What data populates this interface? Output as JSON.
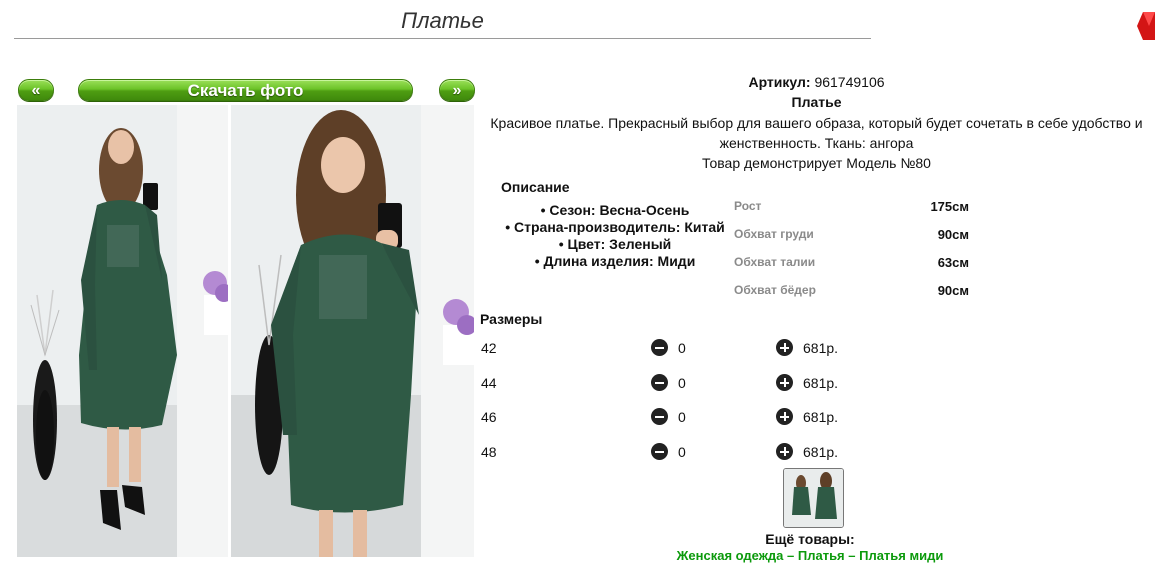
{
  "page": {
    "title": "Платье"
  },
  "gallery": {
    "prev_label": "«",
    "download_label": "Скачать фото",
    "next_label": "»"
  },
  "product": {
    "article_label": "Артикул:",
    "article_value": "961749106",
    "name": "Платье",
    "description": "Красивое платье. Прекрасный выбор для вашего образа, который будет сочетать в себе удобство и женственность. Ткань: ангора",
    "model_note": "Товар демонстрирует Модель №80"
  },
  "description_block": {
    "heading": "Описание",
    "items": [
      "• Сезон: Весна-Осень",
      "• Страна-производитель: Китай",
      "• Цвет: Зеленый",
      "• Длина изделия: Миди"
    ]
  },
  "measurements": [
    {
      "label": "Рост",
      "value": "175см"
    },
    {
      "label": "Обхват груди",
      "value": "90см"
    },
    {
      "label": "Обхват талии",
      "value": "63см"
    },
    {
      "label": "Обхват бёдер",
      "value": "90см"
    }
  ],
  "sizes": {
    "heading": "Размеры",
    "rows": [
      {
        "size": "42",
        "qty": "0",
        "price": "681р."
      },
      {
        "size": "44",
        "qty": "0",
        "price": "681р."
      },
      {
        "size": "46",
        "qty": "0",
        "price": "681р."
      },
      {
        "size": "48",
        "qty": "0",
        "price": "681р."
      }
    ]
  },
  "more": {
    "heading": "Ещё товары:",
    "links": "Женская одежда – Платья – Платья миди"
  },
  "colors": {
    "accent_green": "#4f9d12",
    "dress_green": "#2f5a45",
    "link_green": "#0c9a0c"
  }
}
